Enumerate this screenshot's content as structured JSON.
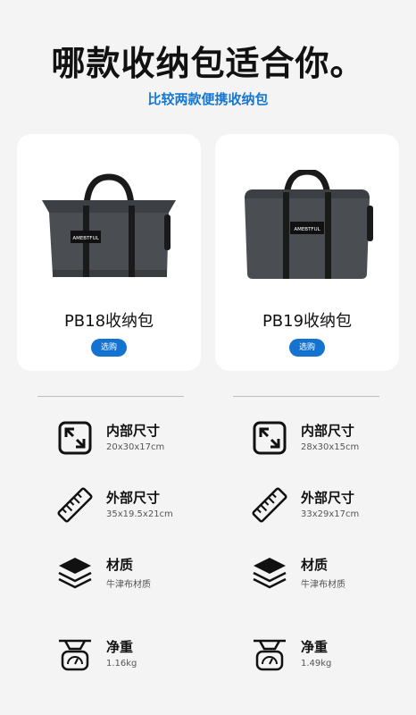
{
  "header": {
    "title": "哪款收纳包适合你。",
    "subtitle": "比较两款便携收纳包"
  },
  "products": [
    {
      "name": "PB18收纳包",
      "buy_label": "选购",
      "brand_tag": "AMEBTFUL"
    },
    {
      "name": "PB19收纳包",
      "buy_label": "选购",
      "brand_tag": "AMEBTFUL"
    }
  ],
  "specs_left": [
    {
      "icon": "inner-size-icon",
      "label": "内部尺寸",
      "value": "20x30x17cm"
    },
    {
      "icon": "ruler-icon",
      "label": "外部尺寸",
      "value": "35x19.5x21cm"
    },
    {
      "icon": "layers-icon",
      "label": "材质",
      "value": "牛津布材质"
    },
    {
      "icon": "scale-icon",
      "label": "净重",
      "value": "1.16kg"
    }
  ],
  "specs_right": [
    {
      "icon": "inner-size-icon",
      "label": "内部尺寸",
      "value": "28x30x15cm"
    },
    {
      "icon": "ruler-icon",
      "label": "外部尺寸",
      "value": "33x29x17cm"
    },
    {
      "icon": "layers-icon",
      "label": "材质",
      "value": "牛津布材质"
    },
    {
      "icon": "scale-icon",
      "label": "净重",
      "value": "1.49kg"
    }
  ],
  "colors": {
    "accent": "#1677d2",
    "button": "#1473d1",
    "bag": "#4a4d52",
    "strap": "#1a1a1a"
  }
}
